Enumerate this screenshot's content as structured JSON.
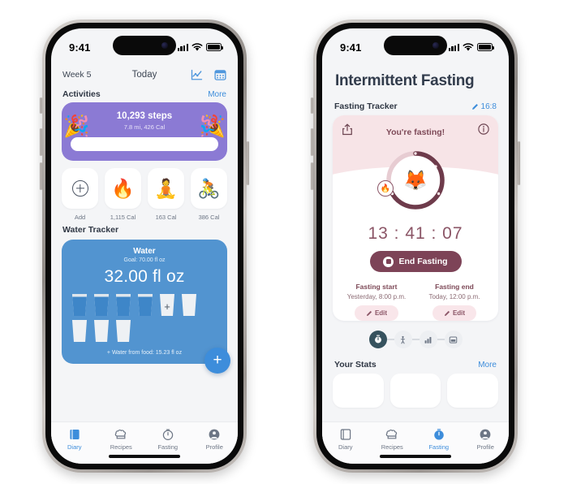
{
  "left_phone": {
    "status_bar": {
      "time": "9:41",
      "signal_icon": "cellular-bars-icon",
      "wifi_icon": "wifi-icon",
      "battery_icon": "battery-full-icon"
    },
    "header": {
      "week_label": "Week 5",
      "date_label": "Today",
      "chart_icon": "line-chart-icon",
      "calendar_icon": "calendar-icon"
    },
    "activities": {
      "section_title": "Activities",
      "more_label": "More",
      "card": {
        "steps": "10,293 steps",
        "subtitle": "7.8 mi, 426 Cal",
        "left_emoji": "party-popper-icon",
        "right_emoji": "party-popper-icon",
        "accent": "#8b7ad4"
      },
      "tiles": [
        {
          "icon": "plus-circle-icon",
          "label": "Add"
        },
        {
          "icon": "fire-icon",
          "label": "1,115 Cal"
        },
        {
          "icon": "yoga-icon",
          "label": "163 Cal"
        },
        {
          "icon": "cyclist-icon",
          "label": "386 Cal"
        }
      ]
    },
    "water": {
      "section_title": "Water Tracker",
      "card_title": "Water",
      "goal": "Goal: 70.00 fl oz",
      "amount": "32.00 fl oz",
      "from_food": "+ Water from food: 15.23 fl oz",
      "glasses_total": 9,
      "glasses_filled": 4,
      "plus_glass_index": 4,
      "accent": "#5294d0",
      "fab_icon": "plus-icon"
    },
    "tabbar": [
      {
        "icon": "book-icon",
        "label": "Diary",
        "active": true
      },
      {
        "icon": "chef-hat-icon",
        "label": "Recipes",
        "active": false
      },
      {
        "icon": "timer-icon",
        "label": "Fasting",
        "active": false
      },
      {
        "icon": "person-circle-icon",
        "label": "Profile",
        "active": false
      }
    ]
  },
  "right_phone": {
    "status_bar": {
      "time": "9:41",
      "signal_icon": "cellular-bars-icon",
      "wifi_icon": "wifi-icon",
      "battery_icon": "battery-full-icon"
    },
    "page_title": "Intermittent Fasting",
    "tracker": {
      "section_title": "Fasting Tracker",
      "plan_label": "16:8",
      "plan_edit_icon": "pencil-icon",
      "share_icon": "share-icon",
      "info_icon": "info-circle-icon",
      "status": "You're fasting!",
      "mascot_icon": "fox-face-icon",
      "flame_icon": "fire-icon",
      "timer": "13 : 41 : 07",
      "progress_percent": 68,
      "ring_color": "#6e3b4b",
      "ring_track_color": "#e7ccd2",
      "end_button": {
        "label": "End Fasting",
        "icon": "stop-icon",
        "color": "#7d4357"
      },
      "start": {
        "title": "Fasting start",
        "value": "Yesterday, 8:00 p.m.",
        "edit_label": "Edit",
        "edit_icon": "pencil-icon"
      },
      "end": {
        "title": "Fasting end",
        "value": "Today, 12:00 p.m.",
        "edit_label": "Edit",
        "edit_icon": "pencil-icon"
      },
      "stages": [
        {
          "icon": "stopwatch-icon",
          "active": true
        },
        {
          "icon": "person-icon",
          "active": false
        },
        {
          "icon": "bar-chart-icon",
          "active": false
        },
        {
          "icon": "window-icon",
          "active": false
        }
      ]
    },
    "stats": {
      "section_title": "Your Stats",
      "more_label": "More",
      "card_count": 3
    },
    "tabbar": [
      {
        "icon": "book-icon",
        "label": "Diary",
        "active": false
      },
      {
        "icon": "chef-hat-icon",
        "label": "Recipes",
        "active": false
      },
      {
        "icon": "timer-icon",
        "label": "Fasting",
        "active": true
      },
      {
        "icon": "person-circle-icon",
        "label": "Profile",
        "active": false
      }
    ]
  }
}
